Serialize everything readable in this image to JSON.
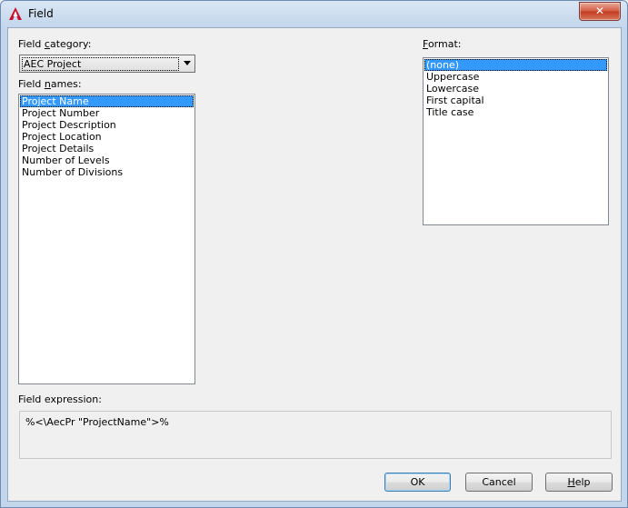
{
  "window": {
    "title": "Field",
    "close_glyph": "✕"
  },
  "field_category": {
    "label_pre": "Field ",
    "label_accel": "c",
    "label_post": "ategory:",
    "selected": "AEC Project"
  },
  "field_names": {
    "label_pre": "Field ",
    "label_accel": "n",
    "label_post": "ames:",
    "items": [
      "Project Name",
      "Project Number",
      "Project Description",
      "Project Location",
      "Project Details",
      "Number of Levels",
      "Number of Divisions"
    ],
    "selected_index": 0
  },
  "format": {
    "label_accel": "F",
    "label_post": "ormat:",
    "items": [
      "(none)",
      "Uppercase",
      "Lowercase",
      "First capital",
      "Title case"
    ],
    "selected_index": 0
  },
  "field_expression": {
    "label": "Field expression:",
    "value": "%<\\AecPr \"ProjectName\">%"
  },
  "buttons": {
    "ok": "OK",
    "cancel": "Cancel",
    "help_accel": "H",
    "help_post": "elp"
  },
  "icons": {
    "title": "autocad-logo-icon",
    "close": "close-icon",
    "dropdown": "chevron-down-icon"
  }
}
